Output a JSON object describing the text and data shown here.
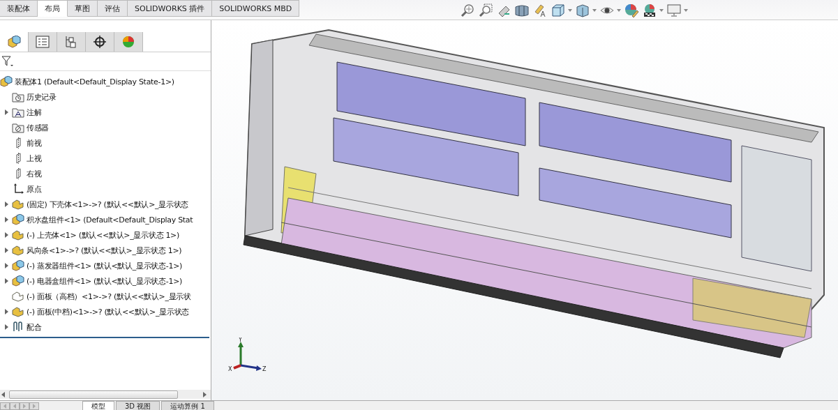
{
  "command_tabs": [
    {
      "label": "装配体",
      "selected": false
    },
    {
      "label": "布局",
      "selected": true
    },
    {
      "label": "草图",
      "selected": false
    },
    {
      "label": "评估",
      "selected": false
    },
    {
      "label": "SOLIDWORKS 插件",
      "selected": false
    },
    {
      "label": "SOLIDWORKS MBD",
      "selected": false
    }
  ],
  "view_toolbar": [
    {
      "kind": "zoom-fit",
      "dropdown": false
    },
    {
      "kind": "zoom-area",
      "dropdown": false
    },
    {
      "kind": "previous-view",
      "dropdown": false
    },
    {
      "kind": "section-view",
      "dropdown": false
    },
    {
      "kind": "annotation-view",
      "dropdown": false
    },
    {
      "kind": "view-orientation",
      "dropdown": true
    },
    {
      "kind": "display-style",
      "dropdown": true
    },
    {
      "kind": "hide-show",
      "dropdown": true
    },
    {
      "kind": "edit-appearance",
      "dropdown": false
    },
    {
      "kind": "apply-scene",
      "dropdown": true
    },
    {
      "kind": "view-settings",
      "dropdown": true
    }
  ],
  "panel_tabs": [
    {
      "kind": "feature-tree",
      "selected": true
    },
    {
      "kind": "property",
      "selected": false
    },
    {
      "kind": "configuration",
      "selected": false
    },
    {
      "kind": "dimxpert",
      "selected": false
    },
    {
      "kind": "display",
      "selected": false
    }
  ],
  "feature_tree": {
    "root": {
      "label": "装配体1  (Default<Default_Display State-1>)",
      "kind": "assembly",
      "children": [
        {
          "label": "历史记录",
          "kind": "history",
          "collapsible": false
        },
        {
          "label": "注解",
          "kind": "annotations",
          "collapsible": true
        },
        {
          "label": "传感器",
          "kind": "sensors",
          "collapsible": false
        },
        {
          "label": "前视",
          "kind": "plane",
          "collapsible": false
        },
        {
          "label": "上视",
          "kind": "plane",
          "collapsible": false
        },
        {
          "label": "右视",
          "kind": "plane",
          "collapsible": false
        },
        {
          "label": "原点",
          "kind": "origin",
          "collapsible": false
        },
        {
          "label": "(固定) 下壳体<1>->? (默认<<默认>_显示状态",
          "kind": "part",
          "collapsible": true
        },
        {
          "label": "积水盘组件<1> (Default<Default_Display Stat",
          "kind": "assembly",
          "collapsible": true
        },
        {
          "label": "(-) 上壳体<1> (默认<<默认>_显示状态 1>)",
          "kind": "part",
          "collapsible": true
        },
        {
          "label": "风向条<1>->? (默认<<默认>_显示状态 1>)",
          "kind": "part",
          "collapsible": true
        },
        {
          "label": "(-) 蒸发器组件<1> (默认<默认_显示状态-1>)",
          "kind": "assembly",
          "collapsible": true
        },
        {
          "label": "(-) 电器盒组件<1> (默认<默认_显示状态-1>)",
          "kind": "assembly",
          "collapsible": true
        },
        {
          "label": "(-) 面板（高档）<1>->? (默认<<默认>_显示状",
          "kind": "hidden-part",
          "collapsible": false
        },
        {
          "label": "(-) 面板(中档)<1>->? (默认<<默认>_显示状态",
          "kind": "part",
          "collapsible": true
        },
        {
          "label": "配合",
          "kind": "mates",
          "collapsible": true
        }
      ]
    }
  },
  "triad": {
    "x": "X",
    "y": "Y",
    "z": "Z"
  },
  "bottom_tabs": [
    {
      "label": "模型",
      "selected": true
    },
    {
      "label": "3D 视图",
      "selected": false
    },
    {
      "label": "运动算例 1",
      "selected": false
    }
  ]
}
